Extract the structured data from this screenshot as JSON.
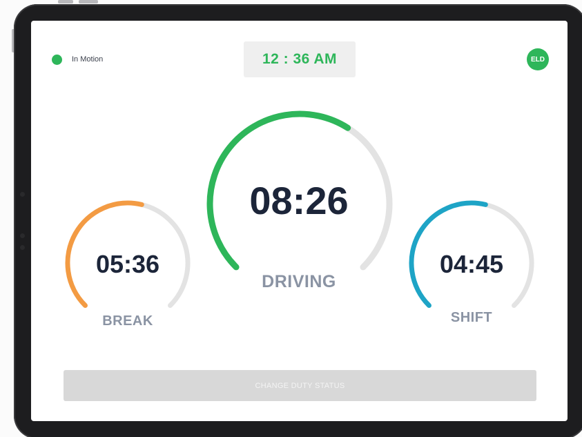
{
  "status": {
    "label": "In Motion",
    "color": "#2eb65a"
  },
  "clock": {
    "time": "12 : 36 AM"
  },
  "badge": {
    "label": "ELD"
  },
  "gauges": {
    "driving": {
      "value": "08:26",
      "label": "DRIVING",
      "color": "#2eb65a",
      "progress": 0.62
    },
    "break": {
      "value": "05:36",
      "label": "BREAK",
      "color": "#f39b43",
      "progress": 0.55
    },
    "shift": {
      "value": "04:45",
      "label": "SHIFT",
      "color": "#1ea4c6",
      "progress": 0.55
    },
    "track_color": "#e3e3e3"
  },
  "actions": {
    "change_duty_status": "CHANGE DUTY STATUS"
  }
}
